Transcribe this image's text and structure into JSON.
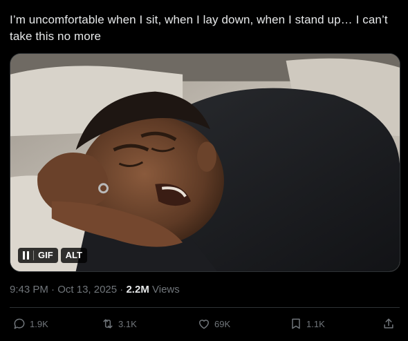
{
  "tweet": {
    "text": "I’m uncomfortable when I sit, when I lay down, when I stand up… I can’t take this no more"
  },
  "media": {
    "controls": {
      "pause_icon": "pause-icon",
      "gif_label": "GIF",
      "alt_label": "ALT"
    }
  },
  "meta": {
    "time": "9:43 PM",
    "dot1": "·",
    "date": "Oct 13, 2025",
    "dot2": "·",
    "views_count": "2.2M",
    "views_label": "Views"
  },
  "actions": {
    "reply": {
      "icon": "reply-icon",
      "count": "1.9K"
    },
    "retweet": {
      "icon": "retweet-icon",
      "count": "3.1K"
    },
    "like": {
      "icon": "heart-icon",
      "count": "69K"
    },
    "bookmark": {
      "icon": "bookmark-icon",
      "count": "1.1K"
    },
    "share": {
      "icon": "share-icon"
    }
  },
  "colors": {
    "background": "#000000",
    "text": "#e7e9ea",
    "secondary": "#71767b",
    "border": "#2f3336"
  }
}
